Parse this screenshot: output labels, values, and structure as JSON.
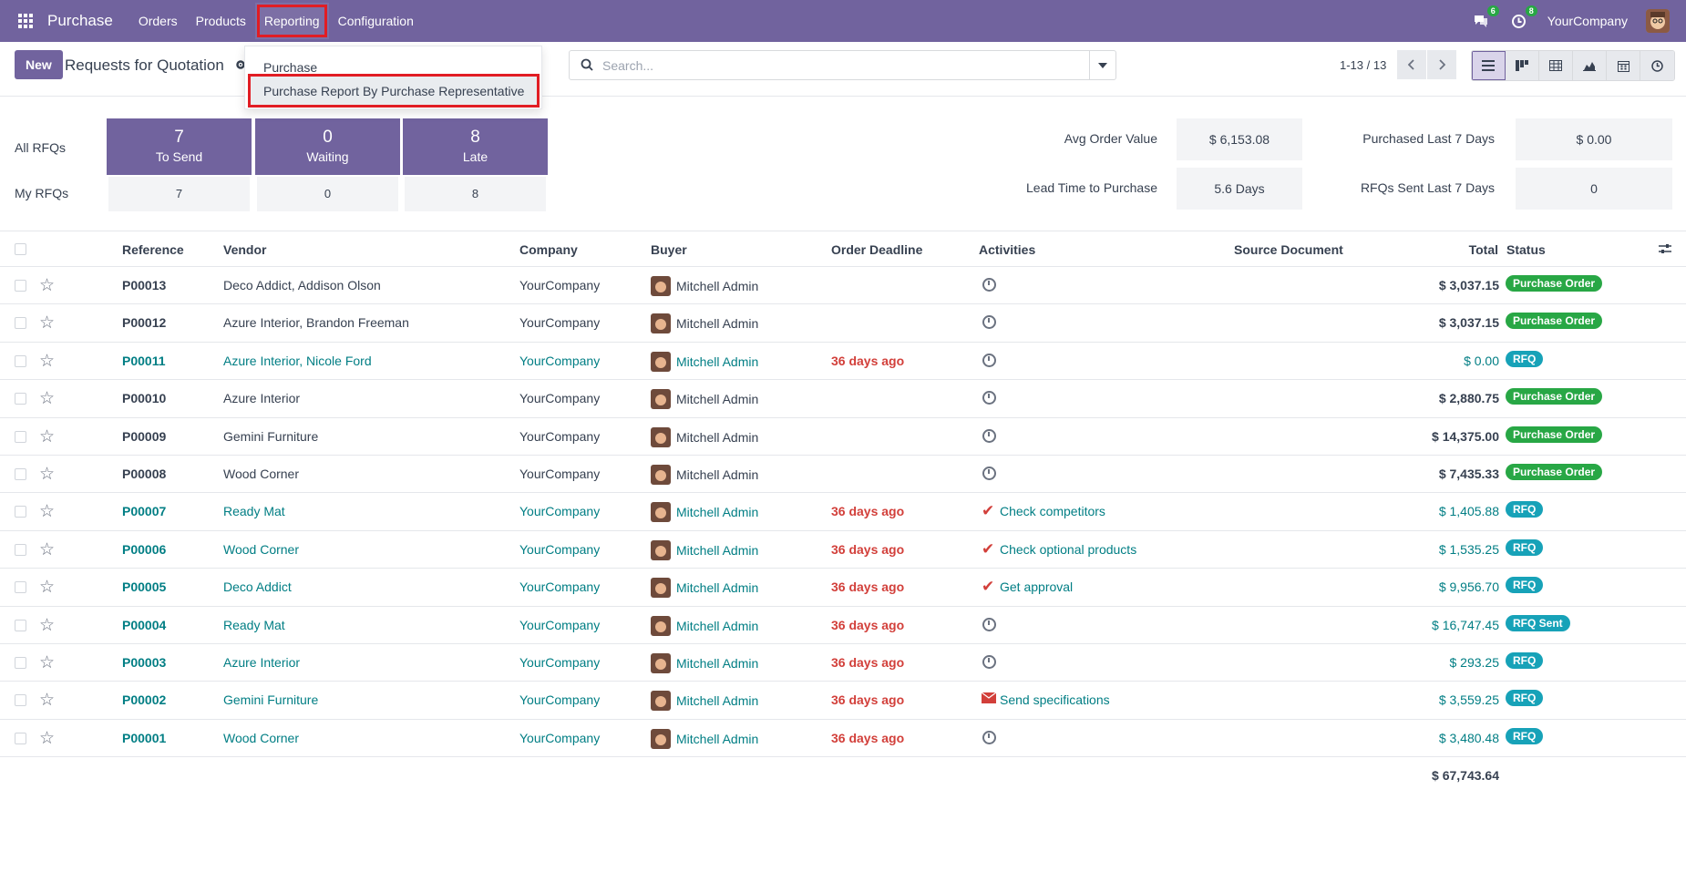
{
  "app": {
    "brand": "Purchase",
    "menu": [
      "Orders",
      "Products",
      "Reporting",
      "Configuration"
    ],
    "company": "YourCompany",
    "chat_badge": "6",
    "activity_badge": "8"
  },
  "control": {
    "new_label": "New",
    "title": "Requests for Quotation",
    "search_placeholder": "Search...",
    "pager": "1-13 / 13"
  },
  "dropdown": {
    "items": [
      "Purchase",
      "Purchase Report By Purchase Representative"
    ]
  },
  "dashboard": {
    "all_rfqs_label": "All RFQs",
    "my_rfqs_label": "My RFQs",
    "tiles": [
      {
        "num": "7",
        "label": "To Send",
        "my": "7"
      },
      {
        "num": "0",
        "label": "Waiting",
        "my": "0"
      },
      {
        "num": "8",
        "label": "Late",
        "my": "8"
      }
    ],
    "kpis": [
      {
        "label": "Avg Order Value",
        "value": "$ 6,153.08"
      },
      {
        "label": "Lead Time to Purchase",
        "value": "5.6 Days"
      },
      {
        "label": "Purchased Last 7 Days",
        "value": "$ 0.00"
      },
      {
        "label": "RFQs Sent Last 7 Days",
        "value": "0"
      }
    ]
  },
  "table": {
    "headers": [
      "Reference",
      "Vendor",
      "Company",
      "Buyer",
      "Order Deadline",
      "Activities",
      "Source Document",
      "Total",
      "Status"
    ],
    "rows": [
      {
        "ref": "P00013",
        "vendor": "Deco Addict, Addison Olson",
        "company": "YourCompany",
        "buyer": "Mitchell Admin",
        "deadline": "",
        "activity": "",
        "act_icon": "clock",
        "total": "$ 3,037.15",
        "status": "Purchase Order",
        "state": "po"
      },
      {
        "ref": "P00012",
        "vendor": "Azure Interior, Brandon Freeman",
        "company": "YourCompany",
        "buyer": "Mitchell Admin",
        "deadline": "",
        "activity": "",
        "act_icon": "clock",
        "total": "$ 3,037.15",
        "status": "Purchase Order",
        "state": "po"
      },
      {
        "ref": "P00011",
        "vendor": "Azure Interior, Nicole Ford",
        "company": "YourCompany",
        "buyer": "Mitchell Admin",
        "deadline": "36 days ago",
        "activity": "",
        "act_icon": "clock",
        "total": "$ 0.00",
        "status": "RFQ",
        "state": "rfq"
      },
      {
        "ref": "P00010",
        "vendor": "Azure Interior",
        "company": "YourCompany",
        "buyer": "Mitchell Admin",
        "deadline": "",
        "activity": "",
        "act_icon": "clock",
        "total": "$ 2,880.75",
        "status": "Purchase Order",
        "state": "po"
      },
      {
        "ref": "P00009",
        "vendor": "Gemini Furniture",
        "company": "YourCompany",
        "buyer": "Mitchell Admin",
        "deadline": "",
        "activity": "",
        "act_icon": "clock",
        "total": "$ 14,375.00",
        "status": "Purchase Order",
        "state": "po"
      },
      {
        "ref": "P00008",
        "vendor": "Wood Corner",
        "company": "YourCompany",
        "buyer": "Mitchell Admin",
        "deadline": "",
        "activity": "",
        "act_icon": "clock",
        "total": "$ 7,435.33",
        "status": "Purchase Order",
        "state": "po"
      },
      {
        "ref": "P00007",
        "vendor": "Ready Mat",
        "company": "YourCompany",
        "buyer": "Mitchell Admin",
        "deadline": "36 days ago",
        "activity": "Check competitors",
        "act_icon": "check",
        "total": "$ 1,405.88",
        "status": "RFQ",
        "state": "rfq"
      },
      {
        "ref": "P00006",
        "vendor": "Wood Corner",
        "company": "YourCompany",
        "buyer": "Mitchell Admin",
        "deadline": "36 days ago",
        "activity": "Check optional products",
        "act_icon": "check",
        "total": "$ 1,535.25",
        "status": "RFQ",
        "state": "rfq"
      },
      {
        "ref": "P00005",
        "vendor": "Deco Addict",
        "company": "YourCompany",
        "buyer": "Mitchell Admin",
        "deadline": "36 days ago",
        "activity": "Get approval",
        "act_icon": "check",
        "total": "$ 9,956.70",
        "status": "RFQ",
        "state": "rfq"
      },
      {
        "ref": "P00004",
        "vendor": "Ready Mat",
        "company": "YourCompany",
        "buyer": "Mitchell Admin",
        "deadline": "36 days ago",
        "activity": "",
        "act_icon": "clock",
        "total": "$ 16,747.45",
        "status": "RFQ Sent",
        "state": "rfq"
      },
      {
        "ref": "P00003",
        "vendor": "Azure Interior",
        "company": "YourCompany",
        "buyer": "Mitchell Admin",
        "deadline": "36 days ago",
        "activity": "",
        "act_icon": "clock",
        "total": "$ 293.25",
        "status": "RFQ",
        "state": "rfq"
      },
      {
        "ref": "P00002",
        "vendor": "Gemini Furniture",
        "company": "YourCompany",
        "buyer": "Mitchell Admin",
        "deadline": "36 days ago",
        "activity": "Send specifications",
        "act_icon": "envelope",
        "total": "$ 3,559.25",
        "status": "RFQ",
        "state": "rfq"
      },
      {
        "ref": "P00001",
        "vendor": "Wood Corner",
        "company": "YourCompany",
        "buyer": "Mitchell Admin",
        "deadline": "36 days ago",
        "activity": "",
        "act_icon": "clock",
        "total": "$ 3,480.48",
        "status": "RFQ",
        "state": "rfq"
      }
    ],
    "grand_total": "$ 67,743.64"
  },
  "colors": {
    "brand": "#71639e",
    "link": "#017e84",
    "late": "#d23f3a",
    "po_badge": "#28a745",
    "rfq_badge": "#17a2b8"
  }
}
